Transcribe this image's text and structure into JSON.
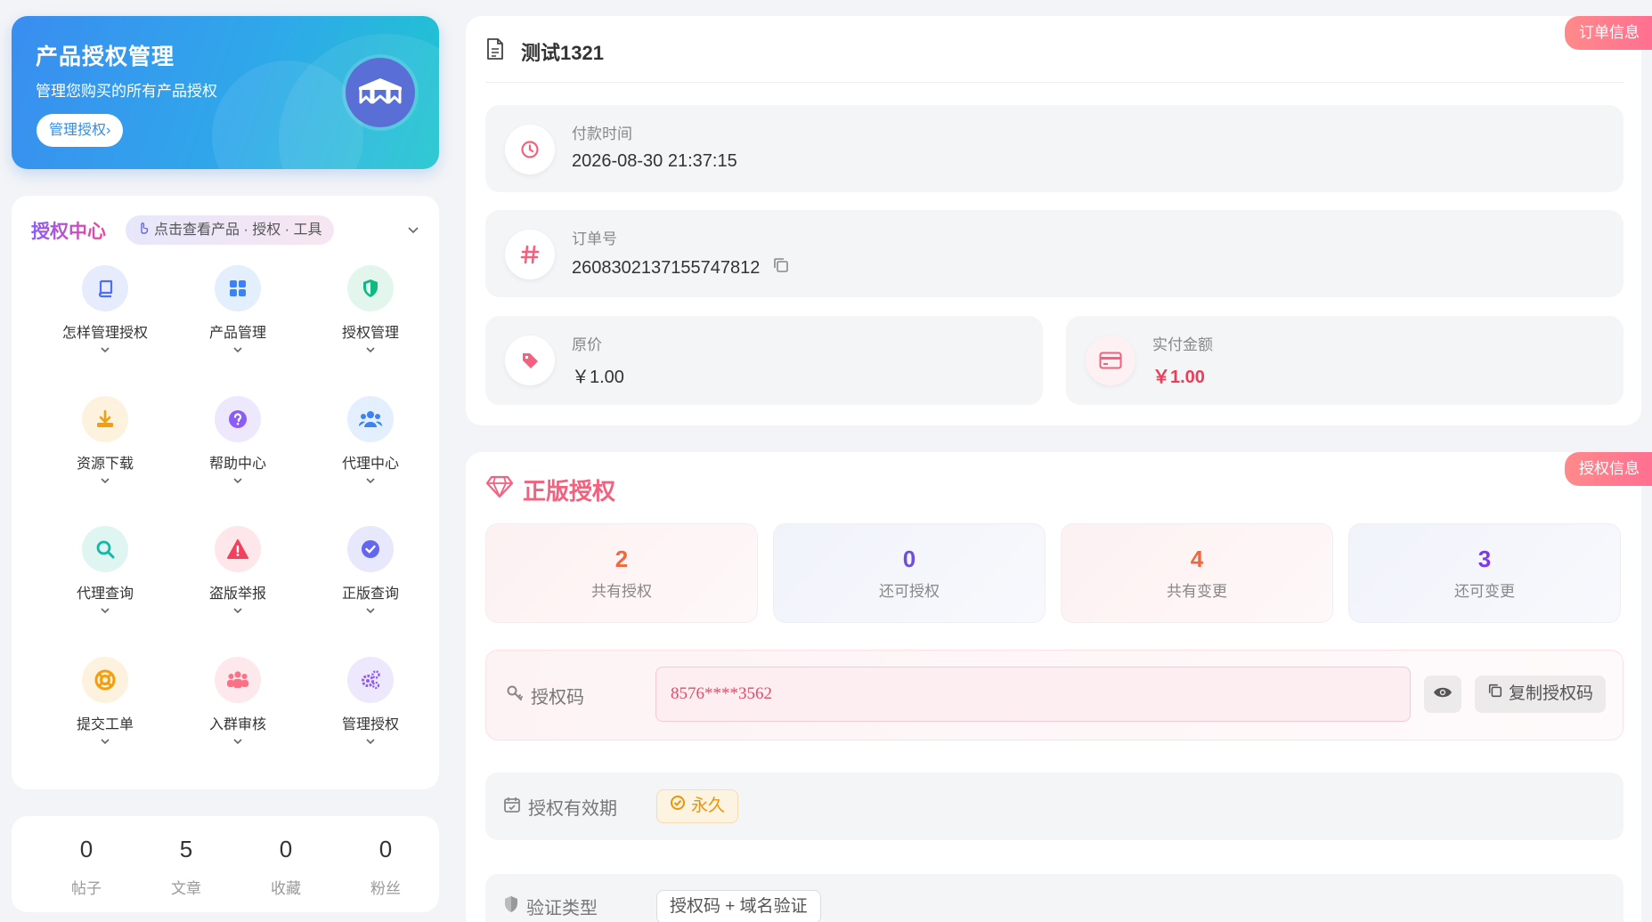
{
  "hero": {
    "title": "产品授权管理",
    "subtitle": "管理您购买的所有产品授权",
    "button": "管理授权›"
  },
  "auth_center": {
    "title": "授权中心",
    "pill": "点击查看产品 · 授权 · 工具",
    "items": [
      {
        "label": "怎样管理授权",
        "icon": "book-icon",
        "color": "#4f6ef0"
      },
      {
        "label": "产品管理",
        "icon": "grid-icon",
        "color": "#3b82f6"
      },
      {
        "label": "授权管理",
        "icon": "shield-icon",
        "color": "#10b981"
      },
      {
        "label": "资源下载",
        "icon": "download-icon",
        "color": "#f59e0b"
      },
      {
        "label": "帮助中心",
        "icon": "question-icon",
        "color": "#8b5cf6"
      },
      {
        "label": "代理中心",
        "icon": "users-icon",
        "color": "#3b82f6"
      },
      {
        "label": "代理查询",
        "icon": "search-icon",
        "color": "#14b8a6"
      },
      {
        "label": "盗版举报",
        "icon": "warning-icon",
        "color": "#f43f5e"
      },
      {
        "label": "正版查询",
        "icon": "check-circle-icon",
        "color": "#6366f1"
      },
      {
        "label": "提交工单",
        "icon": "lifebuoy-icon",
        "color": "#f59e0b"
      },
      {
        "label": "入群审核",
        "icon": "group-icon",
        "color": "#fb7185"
      },
      {
        "label": "管理授权",
        "icon": "cogs-icon",
        "color": "#8b5cf6"
      }
    ]
  },
  "stats": [
    {
      "value": "0",
      "label": "帖子"
    },
    {
      "value": "5",
      "label": "文章"
    },
    {
      "value": "0",
      "label": "收藏"
    },
    {
      "value": "0",
      "label": "粉丝"
    }
  ],
  "order": {
    "ribbon": "订单信息",
    "title": "测试1321",
    "pay_time_label": "付款时间",
    "pay_time": "2026-08-30 21:37:15",
    "order_no_label": "订单号",
    "order_no": "2608302137155747812",
    "orig_price_label": "原价",
    "orig_price": "￥1.00",
    "paid_label": "实付金额",
    "paid": "￥1.00"
  },
  "license": {
    "ribbon": "授权信息",
    "title": "正版授权",
    "counts": [
      {
        "value": "2",
        "label": "共有授权",
        "color": "#f2683d"
      },
      {
        "value": "0",
        "label": "还可授权",
        "color": "#6d4fe0"
      },
      {
        "value": "4",
        "label": "共有变更",
        "color": "#f2683d"
      },
      {
        "value": "3",
        "label": "还可变更",
        "color": "#7c3aed"
      }
    ],
    "code_label": "授权码",
    "code_value": "8576****3562",
    "copy_button": "复制授权码",
    "validity_label": "授权有效期",
    "validity_value": "永久",
    "verify_label": "验证类型",
    "verify_value": "授权码 + 域名验证"
  }
}
